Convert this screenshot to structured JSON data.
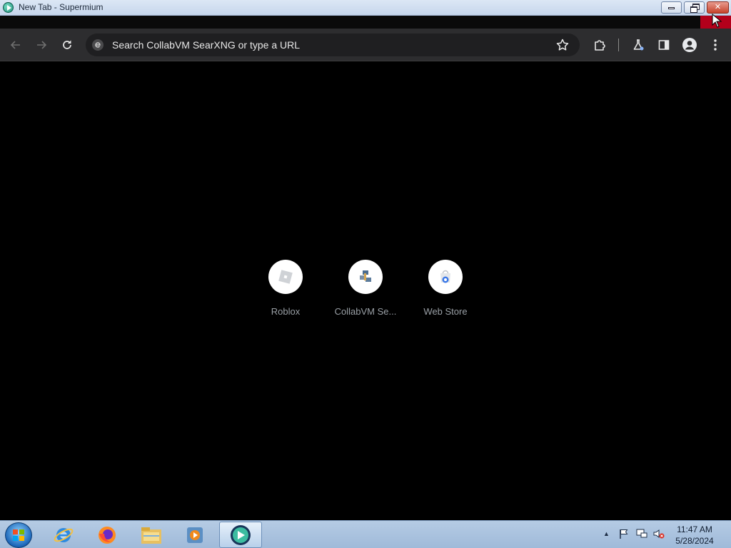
{
  "window": {
    "title": "New Tab - Supermium",
    "minimize_label": "",
    "maximize_label": "",
    "close_label": "✕"
  },
  "toolbar": {
    "back": "←",
    "forward": "→",
    "omnibox_placeholder": "Search CollabVM SearXNG or type a URL"
  },
  "shortcuts": [
    {
      "label": "Roblox",
      "icon": "roblox-icon"
    },
    {
      "label": "CollabVM Se...",
      "icon": "collabvm-icon"
    },
    {
      "label": "Web Store",
      "icon": "web-store-icon"
    }
  ],
  "taskbar": {
    "apps": [
      "internet-explorer-icon",
      "firefox-icon",
      "file-explorer-icon",
      "media-player-icon",
      "supermium-icon"
    ],
    "clock_time": "11:47 AM",
    "clock_date": "5/28/2024",
    "tray_expand": "▲"
  },
  "colors": {
    "toolbar_bg": "#2d2d2f",
    "omnibox_bg": "#1f1f21",
    "ntp_bg": "#000000",
    "close_red": "#c6422b"
  }
}
